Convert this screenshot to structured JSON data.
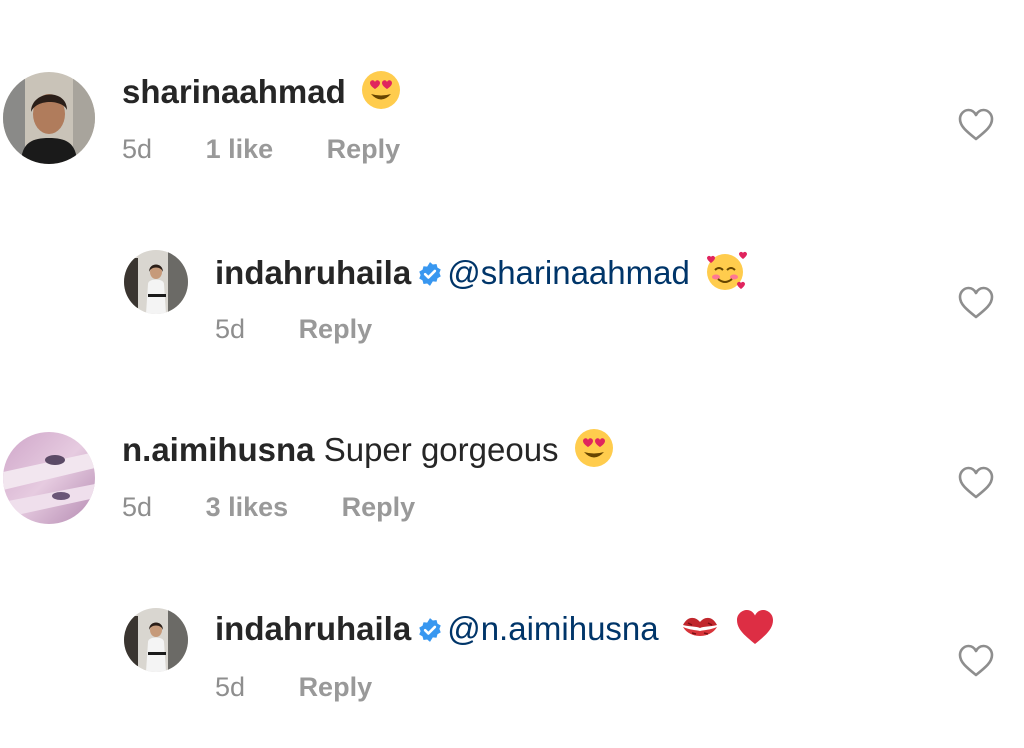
{
  "comments": [
    {
      "username": "sharinaahmad",
      "text": "",
      "emoji": "heart-eyes",
      "time": "5d",
      "likes": "1 like",
      "reply": "Reply"
    },
    {
      "username": "indahruhaila",
      "verified": true,
      "mention": "@sharinaahmad",
      "emoji": "smiling-face-with-hearts",
      "time": "5d",
      "reply": "Reply"
    },
    {
      "username": "n.aimihusna",
      "text": "Super gorgeous",
      "emoji": "heart-eyes",
      "time": "5d",
      "likes": "3 likes",
      "reply": "Reply"
    },
    {
      "username": "indahruhaila",
      "verified": true,
      "mention": "@n.aimihusna",
      "emoji": "kiss-mark, red-heart",
      "time": "5d",
      "reply": "Reply"
    }
  ],
  "colors": {
    "username": "#262626",
    "mention": "#003569",
    "meta": "#8e8e8e",
    "verified": "#3897f0",
    "heart_outline": "#8e8e8e"
  }
}
